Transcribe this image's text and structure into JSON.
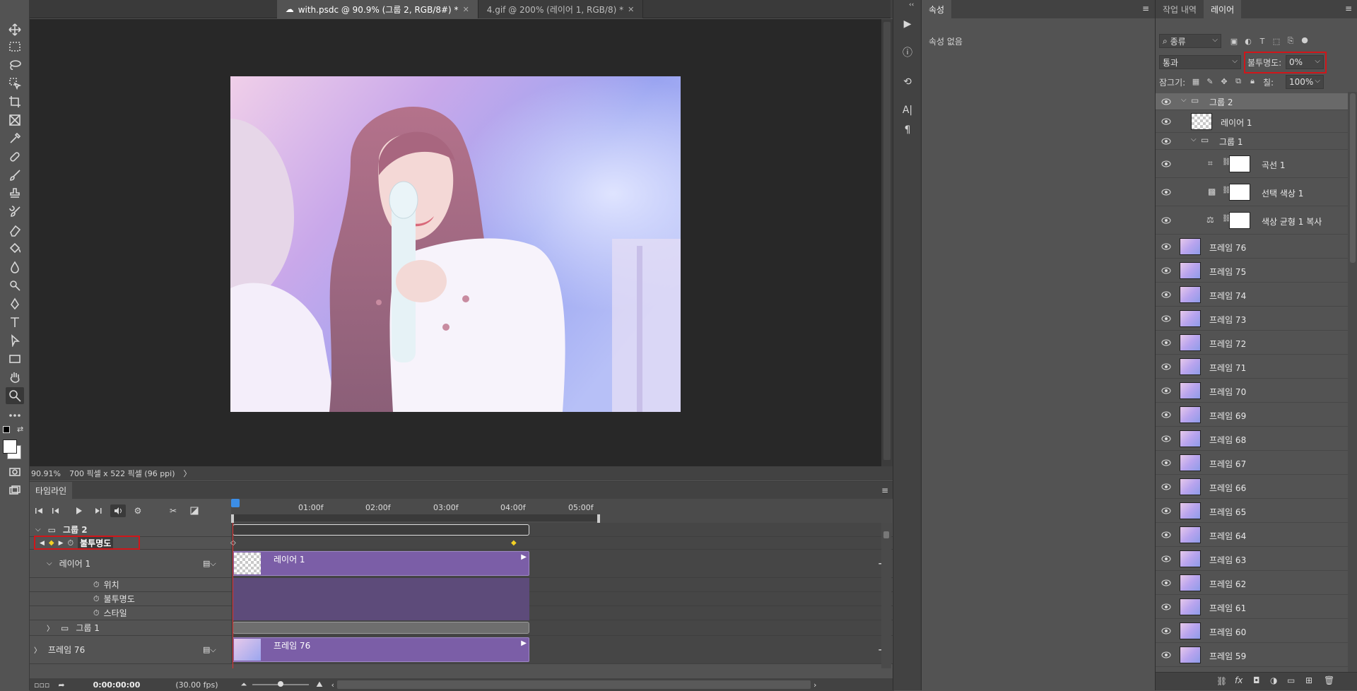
{
  "tabs": [
    {
      "label": "with.psdc @ 90.9% (그룹 2, RGB/8#) *",
      "active": true
    },
    {
      "label": "4.gif @ 200% (레이어 1, RGB/8) *",
      "active": false
    }
  ],
  "canvas": {
    "zoom": "90.91%",
    "doc_info": "700 픽셀 x 522 픽셀 (96 ppi)",
    "arrow": "〉"
  },
  "timeline": {
    "tab_label": "타임라인",
    "ruler_ticks": [
      "01:00f",
      "02:00f",
      "03:00f",
      "04:00f",
      "05:00f"
    ],
    "rows": {
      "group2": {
        "label": "그룹 2"
      },
      "opacity_prop": {
        "label": "불투명도"
      },
      "layer1": {
        "label": "레이어 1",
        "clip_label": "레이어 1"
      },
      "position": {
        "label": "위치"
      },
      "opacity": {
        "label": "불투명도"
      },
      "style": {
        "label": "스타일"
      },
      "group1": {
        "label": "그룹 1"
      },
      "frame76": {
        "label": "프레임 76",
        "clip_label": "프레임 76"
      }
    },
    "timecode": "0:00:00:00",
    "fps": "(30.00 fps)"
  },
  "properties": {
    "tab_label": "속성",
    "empty_text": "속성 없음"
  },
  "layers_panel": {
    "tabs": [
      "작업 내역",
      "레이어"
    ],
    "filter_kind": "종류",
    "blend_mode": "통과",
    "opacity_label": "불투명도:",
    "opacity_value": "0%",
    "lock_label": "잠그기:",
    "fill_label": "칠:",
    "fill_value": "100%",
    "layers": [
      {
        "name": "그룹 2",
        "type": "group"
      },
      {
        "name": "레이어 1",
        "type": "transparent"
      },
      {
        "name": "그룹 1",
        "type": "group"
      },
      {
        "name": "곡선 1",
        "type": "adjustment"
      },
      {
        "name": "선택 색상 1",
        "type": "adjustment"
      },
      {
        "name": "색상 균형 1 복사",
        "type": "adjustment"
      },
      {
        "name": "프레임 76",
        "type": "image"
      },
      {
        "name": "프레임 75",
        "type": "image"
      },
      {
        "name": "프레임 74",
        "type": "image"
      },
      {
        "name": "프레임 73",
        "type": "image"
      },
      {
        "name": "프레임 72",
        "type": "image"
      },
      {
        "name": "프레임 71",
        "type": "image"
      },
      {
        "name": "프레임 70",
        "type": "image"
      },
      {
        "name": "프레임 69",
        "type": "image"
      },
      {
        "name": "프레임 68",
        "type": "image"
      },
      {
        "name": "프레임 67",
        "type": "image"
      },
      {
        "name": "프레임 66",
        "type": "image"
      },
      {
        "name": "프레임 65",
        "type": "image"
      },
      {
        "name": "프레임 64",
        "type": "image"
      },
      {
        "name": "프레임 63",
        "type": "image"
      },
      {
        "name": "프레임 62",
        "type": "image"
      },
      {
        "name": "프레임 61",
        "type": "image"
      },
      {
        "name": "프레임 60",
        "type": "image"
      },
      {
        "name": "프레임 59",
        "type": "image"
      }
    ]
  },
  "colors": {
    "clip_purple": "#7b5ea7",
    "highlight_red": "#d0161a",
    "keyframe_yellow": "#f2d024"
  }
}
